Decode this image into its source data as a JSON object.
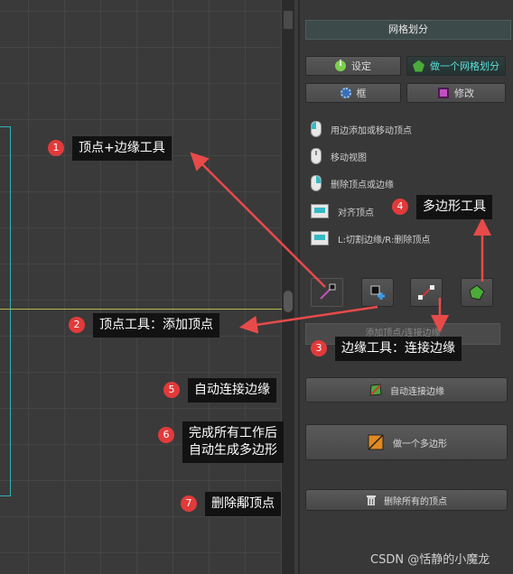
{
  "panel": {
    "title": "网格划分",
    "buttons": {
      "settings": "设定",
      "make_mesh": "做一个网格划分",
      "frame": "框",
      "edit": "修改"
    },
    "help": [
      {
        "icon": "mouse-left-icon",
        "text": "用边添加或移动顶点"
      },
      {
        "icon": "mouse-middle-icon",
        "text": "移动视图"
      },
      {
        "icon": "mouse-right-icon",
        "text": "删除顶点或边缘"
      },
      {
        "icon": "keyboard-icon",
        "text": "对齐顶点"
      },
      {
        "icon": "keyboard-icon",
        "text": "L:切割边缘/R:删除顶点"
      }
    ],
    "tool_hint": "添加顶点/连接边缘",
    "auto_connect": "自动连接边缘",
    "make_polygon": "做一个多边形",
    "delete_all": "删除所有的顶点"
  },
  "annotations": {
    "a1": {
      "num": "1",
      "text": "顶点+边缘工具"
    },
    "a2": {
      "num": "2",
      "text": "顶点工具：添加顶点"
    },
    "a3": {
      "num": "3",
      "text": "边缘工具：连接边缘"
    },
    "a4": {
      "num": "4",
      "text": "多边形工具"
    },
    "a5": {
      "num": "5",
      "text": "自动连接边缘"
    },
    "a6": {
      "num": "6",
      "line1": "完成所有工作后",
      "line2": "自动生成多边形"
    },
    "a7": {
      "num": "7",
      "text": "删除鄅顶点"
    }
  },
  "colors": {
    "accent_cyan": "#56e0d8",
    "annotation_red": "#e23a3a",
    "arrow_red": "#e84a4a"
  },
  "watermark": "CSDN @恬静的小魔龙"
}
